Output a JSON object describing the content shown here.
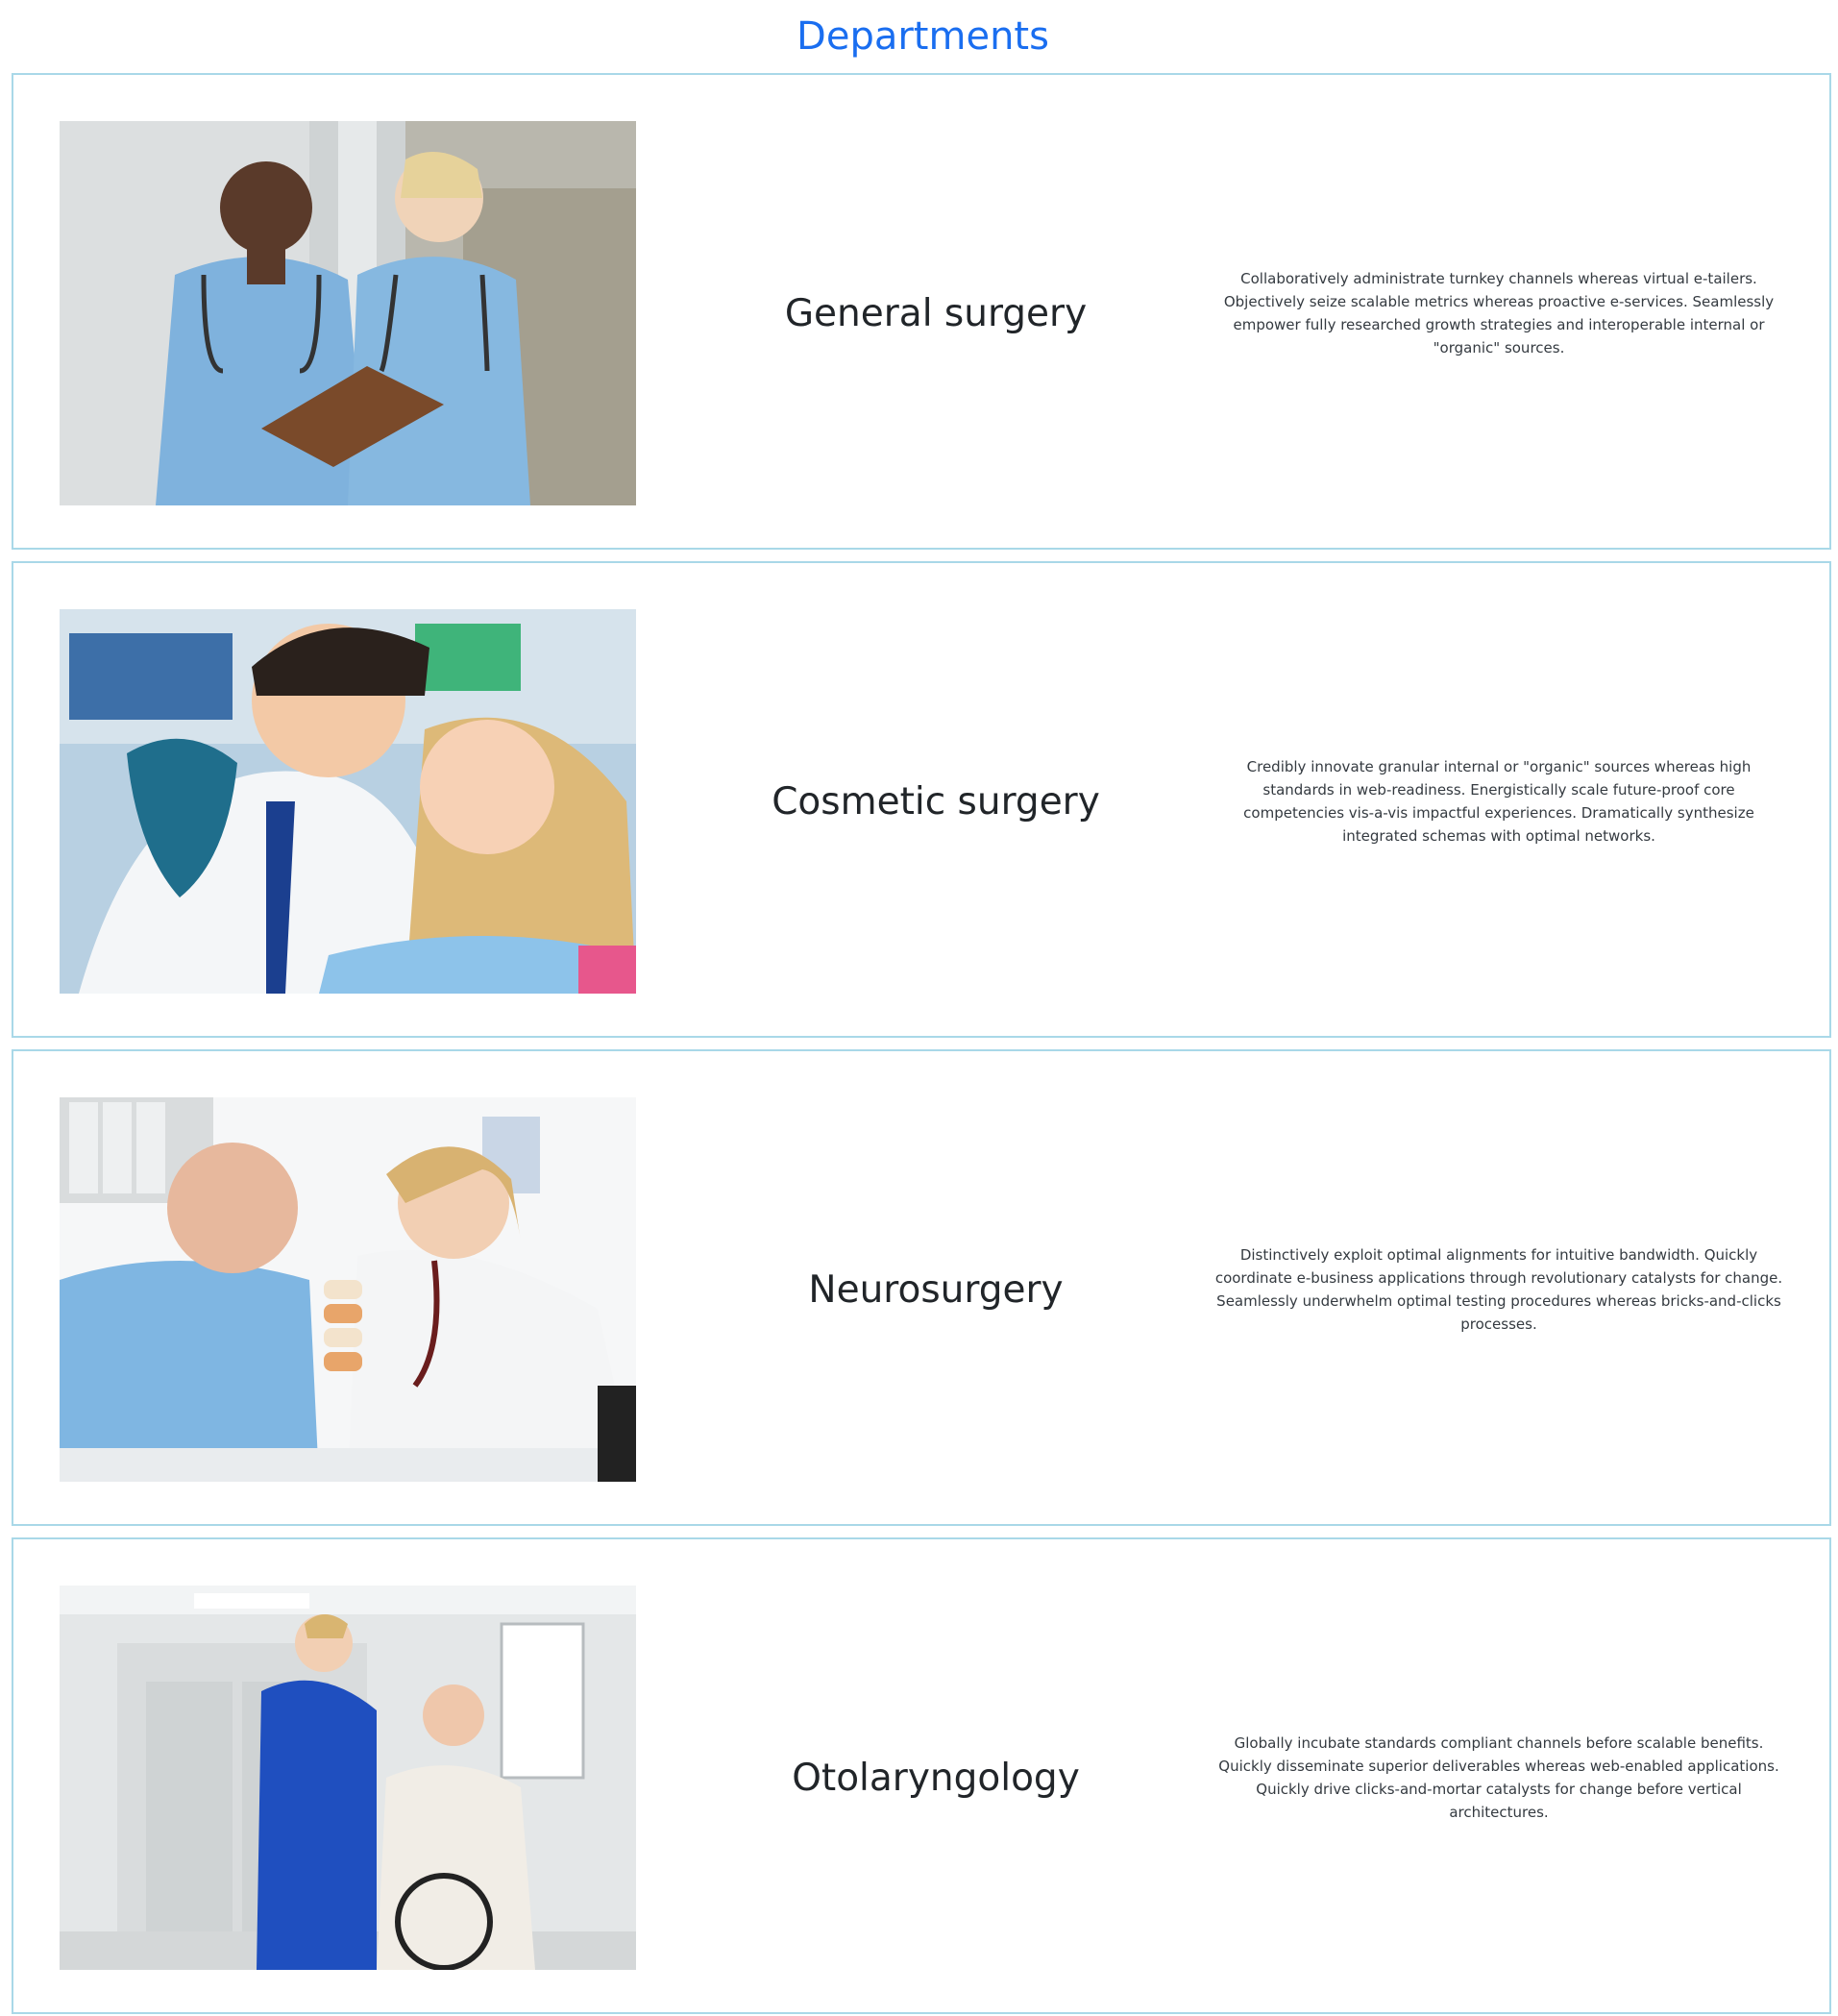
{
  "page": {
    "title": "Departments"
  },
  "colors": {
    "title": "#1a6ef0",
    "card_border": "#a9d8e8",
    "text": "#212529"
  },
  "departments": [
    {
      "name": "General surgery",
      "description": "Collaboratively administrate turnkey channels whereas virtual e-tailers. Objectively seize scalable metrics whereas proactive e-services. Seamlessly empower fully researched growth strategies and interoperable internal or \"organic\" sources.",
      "photo": "two-nurses-with-clipboard-photo"
    },
    {
      "name": "Cosmetic surgery",
      "description": "Credibly innovate granular internal or \"organic\" sources whereas high standards in web-readiness. Energistically scale future-proof core competencies vis-a-vis impactful experiences. Dramatically synthesize integrated schemas with optimal networks.",
      "photo": "dentist-with-patient-photo"
    },
    {
      "name": "Neurosurgery",
      "description": "Distinctively exploit optimal alignments for intuitive bandwidth. Quickly coordinate e-business applications through revolutionary catalysts for change. Seamlessly underwhelm optimal testing procedures whereas bricks-and-clicks processes.",
      "photo": "doctor-with-elderly-patient-photo"
    },
    {
      "name": "Otolaryngology",
      "description": "Globally incubate standards compliant channels before scalable benefits. Quickly disseminate superior deliverables whereas web-enabled applications. Quickly drive clicks-and-mortar catalysts for change before vertical architectures.",
      "photo": "nurse-with-wheelchair-patient-photo"
    }
  ]
}
